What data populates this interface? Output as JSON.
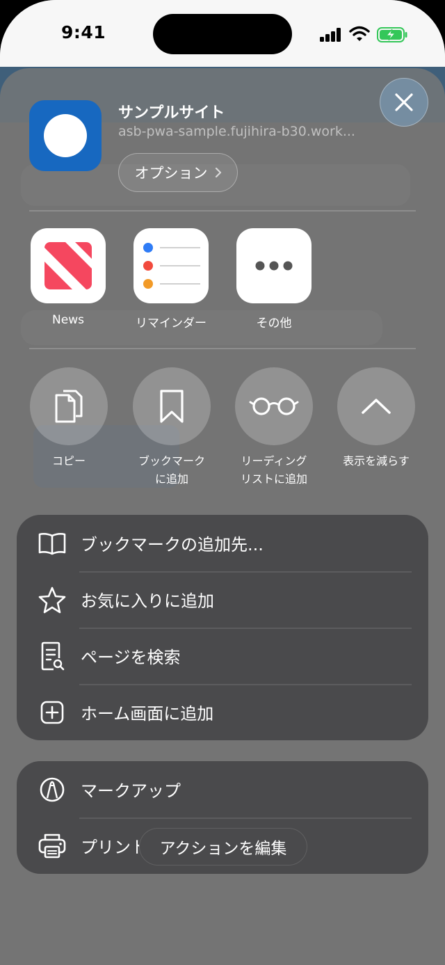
{
  "status": {
    "time": "9:41"
  },
  "site": {
    "title": "サンプルサイト",
    "url": "asb-pwa-sample.fujihira-b30.work...",
    "options_label": "オプション"
  },
  "share_apps": [
    {
      "label": "News",
      "icon": "news-icon"
    },
    {
      "label": "リマインダー",
      "icon": "reminders-icon"
    },
    {
      "label": "その他",
      "icon": "more-icon"
    }
  ],
  "actions": [
    {
      "line1": "コピー",
      "line2": "",
      "icon": "copy-icon"
    },
    {
      "line1": "ブックマーク",
      "line2": "に追加",
      "icon": "bookmark-icon"
    },
    {
      "line1": "リーディング",
      "line2": "リストに追加",
      "icon": "reading-glasses-icon"
    },
    {
      "line1": "表示を減らす",
      "line2": "",
      "icon": "chevron-up-icon"
    }
  ],
  "menu_group1": [
    {
      "label": "ブックマークの追加先...",
      "icon": "book-icon"
    },
    {
      "label": "お気に入りに追加",
      "icon": "star-icon"
    },
    {
      "label": "ページを検索",
      "icon": "find-in-page-icon"
    },
    {
      "label": "ホーム画面に追加",
      "icon": "add-square-icon"
    }
  ],
  "menu_group2": [
    {
      "label": "マークアップ",
      "icon": "markup-icon"
    },
    {
      "label": "プリント",
      "icon": "printer-icon"
    }
  ],
  "edit_actions_label": "アクションを編集",
  "colors": {
    "app_icon": "#1768c0",
    "news_red": "#f5475f",
    "battery_green": "#34c759"
  }
}
